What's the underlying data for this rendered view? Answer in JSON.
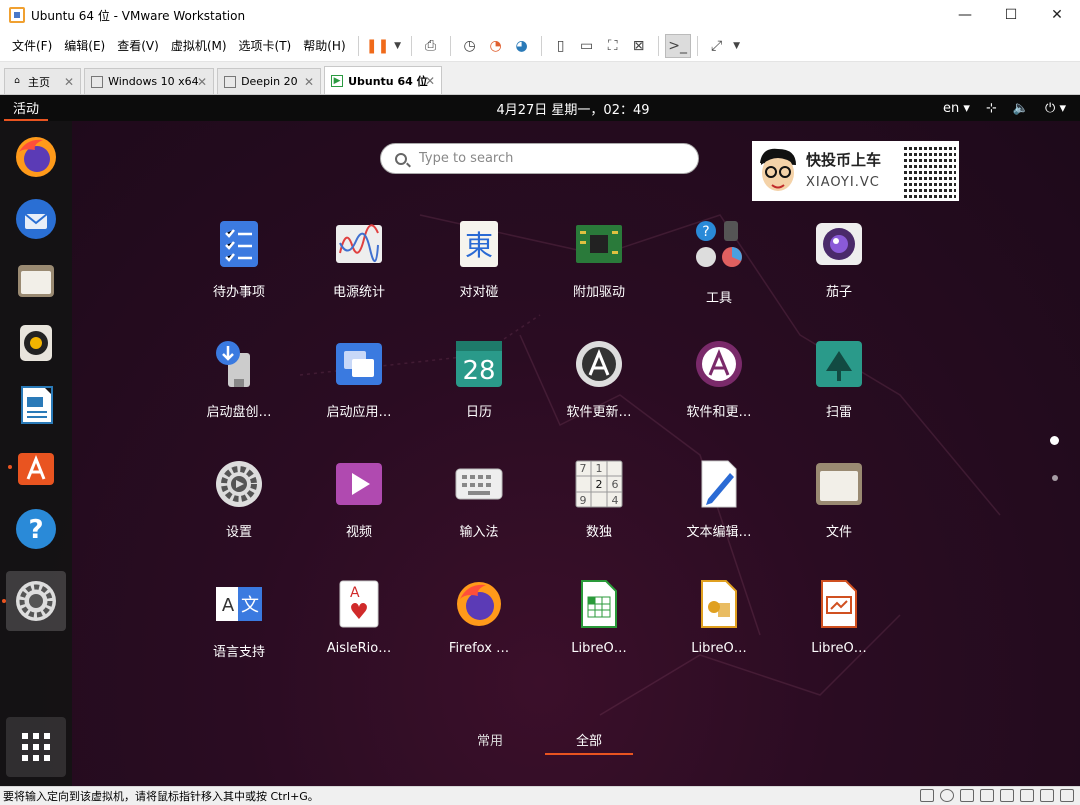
{
  "window": {
    "title": "Ubuntu 64 位 - VMware Workstation",
    "controls": [
      "—",
      "☐",
      "✕"
    ]
  },
  "menubar": {
    "items": [
      "文件(F)",
      "编辑(E)",
      "查看(V)",
      "虚拟机(M)",
      "选项卡(T)",
      "帮助(H)"
    ]
  },
  "tabs": [
    {
      "label": "主页",
      "icon": "home-icon",
      "active": false
    },
    {
      "label": "Windows 10 x64",
      "icon": "vm-icon",
      "active": false
    },
    {
      "label": "Deepin 20",
      "icon": "vm-icon",
      "active": false
    },
    {
      "label": "Ubuntu 64 位",
      "icon": "vm-running-icon",
      "active": true
    }
  ],
  "gnome": {
    "activities": "活动",
    "clock": "4月27日 星期一，02：49",
    "input_source": "en ▾",
    "search_placeholder": "Type to search"
  },
  "watermark": {
    "line1": "快投币上车",
    "line2": "XIAOYI.VC"
  },
  "apps": [
    {
      "label": "待办事项",
      "icon": "todo-icon"
    },
    {
      "label": "电源统计",
      "icon": "power-stats-icon"
    },
    {
      "label": "对对碰",
      "icon": "mahjongg-icon"
    },
    {
      "label": "附加驱动",
      "icon": "chip-icon"
    },
    {
      "label": "工具",
      "icon": "tools-folder-icon"
    },
    {
      "label": "茄子",
      "icon": "cheese-icon"
    },
    {
      "label": "启动盘创…",
      "icon": "usb-creator-icon"
    },
    {
      "label": "启动应用…",
      "icon": "startup-apps-icon"
    },
    {
      "label": "日历",
      "icon": "calendar-icon",
      "text": "28"
    },
    {
      "label": "软件更新…",
      "icon": "software-updater-icon"
    },
    {
      "label": "软件和更…",
      "icon": "software-properties-icon"
    },
    {
      "label": "扫雷",
      "icon": "mines-icon"
    },
    {
      "label": "设置",
      "icon": "settings-icon"
    },
    {
      "label": "视频",
      "icon": "videos-icon"
    },
    {
      "label": "输入法",
      "icon": "keyboard-icon"
    },
    {
      "label": "数独",
      "icon": "sudoku-icon"
    },
    {
      "label": "文本编辑…",
      "icon": "text-editor-icon"
    },
    {
      "label": "文件",
      "icon": "files-icon"
    },
    {
      "label": "语言支持",
      "icon": "language-icon"
    },
    {
      "label": "AisleRio…",
      "icon": "cards-icon"
    },
    {
      "label": "Firefox …",
      "icon": "firefox-icon"
    },
    {
      "label": "LibreO…",
      "icon": "libreoffice-calc-icon"
    },
    {
      "label": "LibreO…",
      "icon": "libreoffice-draw-icon"
    },
    {
      "label": "LibreO…",
      "icon": "libreoffice-impress-icon"
    }
  ],
  "dock": [
    "firefox-icon",
    "thunderbird-icon",
    "files-icon",
    "rhythmbox-icon",
    "libreoffice-writer-icon",
    "software-icon",
    "help-icon",
    "settings-icon",
    "show-apps-icon"
  ],
  "switcher": {
    "frequent": "常用",
    "all": "全部"
  },
  "statusbar": {
    "text": "要将输入定向到该虚拟机，请将鼠标指针移入其中或按 Ctrl+G。"
  }
}
